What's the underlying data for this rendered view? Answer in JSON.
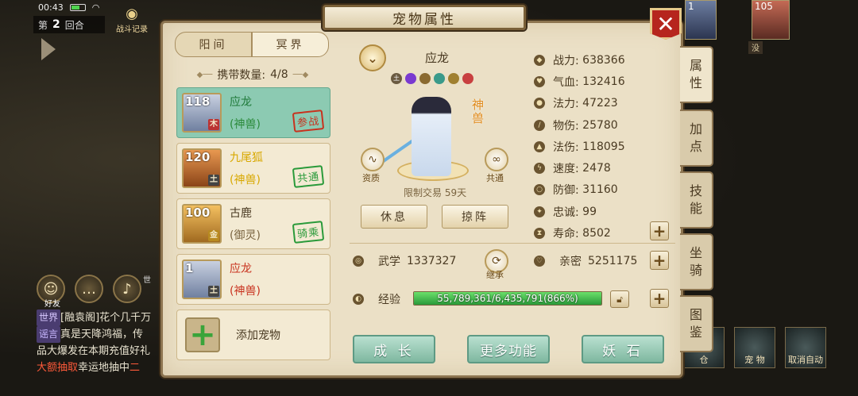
{
  "status": {
    "time": "00:43"
  },
  "round": {
    "prefix": "第",
    "number": "2",
    "suffix": "回合"
  },
  "battle_log": "战斗记录",
  "top_units": [
    {
      "level": "1"
    },
    {
      "level": "105"
    }
  ],
  "side_small": "没",
  "chat": {
    "friend_label": "好友",
    "voice_label": "世",
    "lines": [
      {
        "tag": "世界",
        "text": "[融袁阁]花个几千万"
      },
      {
        "tag": "谣言",
        "text": "真是天降鸿福，传"
      },
      {
        "text": "品大爆发在本期充值好礼"
      },
      {
        "highlight": "大额抽取",
        "text": "幸运地抽中",
        "tail": "二"
      }
    ]
  },
  "bottom_right": [
    {
      "label": "仓"
    },
    {
      "label": "宠 物"
    },
    {
      "label": "取消自动"
    }
  ],
  "panel": {
    "title": "宠物属性",
    "close_symbol": "✕",
    "tabs": {
      "active": "阳间",
      "inactive": "冥界"
    },
    "carry": {
      "label": "携带数量:",
      "value": "4/8"
    },
    "pets": [
      {
        "level": "118",
        "name": "应龙",
        "type": "(神兽)",
        "stamp": "参战",
        "element": "木"
      },
      {
        "level": "120",
        "name": "九尾狐",
        "type": "(神兽)",
        "stamp": "共通",
        "element": "土"
      },
      {
        "level": "100",
        "name": "古鹿",
        "type": "(御灵)",
        "stamp": "骑乘",
        "element": "金"
      },
      {
        "level": "1",
        "name": "应龙",
        "type": "(神兽)",
        "stamp": "",
        "element": "土"
      }
    ],
    "add_pet": "添加宠物",
    "current": {
      "name": "应龙",
      "chev": "⌄",
      "badge": "神兽",
      "aptitude_label": "资质",
      "shared_label": "共通",
      "trade_limit": "限制交易 59天",
      "rest_button": "休息",
      "formation_button": "掠阵"
    },
    "stats": [
      {
        "label": "战力:",
        "value": "638366"
      },
      {
        "label": "气血:",
        "value": "132416"
      },
      {
        "label": "法力:",
        "value": "47223"
      },
      {
        "label": "物伤:",
        "value": "25780"
      },
      {
        "label": "法伤:",
        "value": "118095"
      },
      {
        "label": "速度:",
        "value": "2478"
      },
      {
        "label": "防御:",
        "value": "31160"
      },
      {
        "label": "忠诚:",
        "value": "99"
      },
      {
        "label": "寿命:",
        "value": "8502"
      }
    ],
    "wuxue": {
      "label": "武学",
      "value": "1337327"
    },
    "inherit_label": "继承",
    "intimacy": {
      "label": "亲密",
      "value": "5251175"
    },
    "exp": {
      "label": "经验",
      "text": "55,789,361/6,435,791(866%)",
      "fill_fraction": 1.0
    },
    "bottom_buttons": {
      "grow": "成  长",
      "more": "更多功能",
      "demon_stone": "妖  石"
    },
    "side_tabs": [
      {
        "label": "属\n性"
      },
      {
        "label": "加\n点"
      },
      {
        "label": "技\n能"
      },
      {
        "label": "坐\n骑"
      },
      {
        "label": "图\n鉴"
      }
    ]
  },
  "colors": {
    "panel_bg": "#ebe0c6",
    "selected_card": "#8ccab2",
    "accent_green": "#7fb8a0",
    "close_red": "#b6251d"
  }
}
